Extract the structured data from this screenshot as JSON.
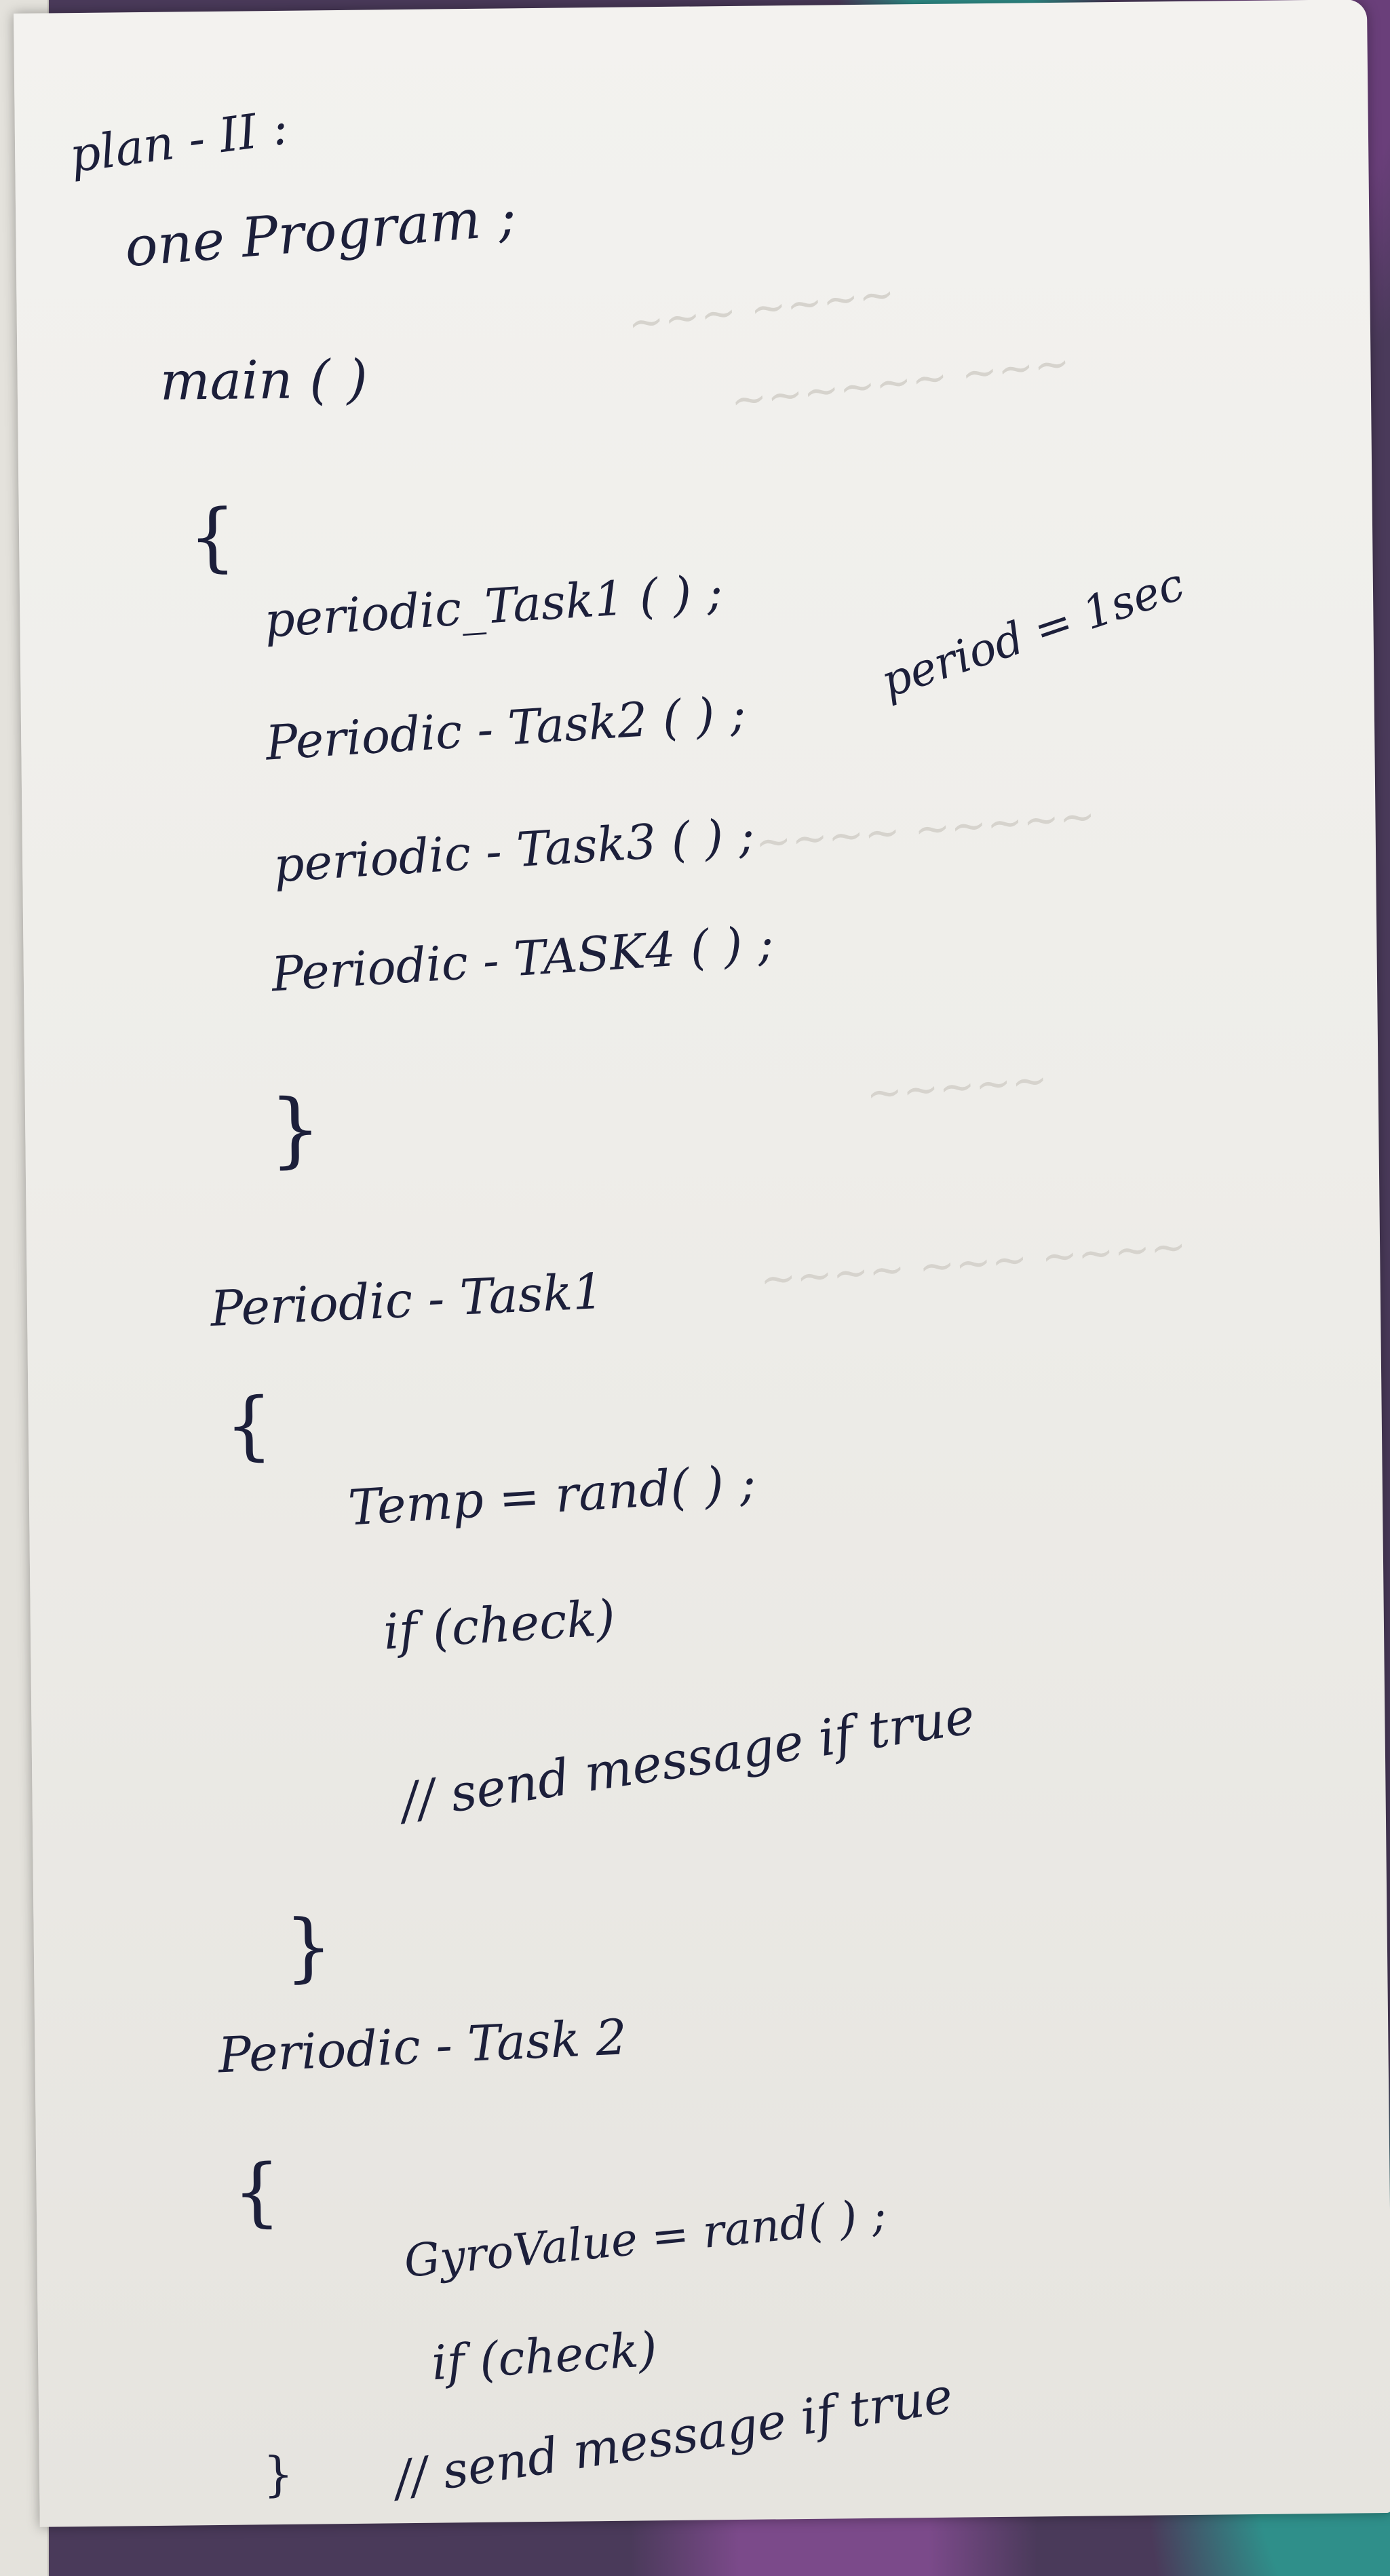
{
  "notes": {
    "heading": "plan - II :",
    "subheading": "one Program ;",
    "main": {
      "signature": "main ( )",
      "open_brace": "{",
      "calls": [
        "periodic_Task1 ( ) ;",
        "Periodic - Task2 ( ) ;",
        "periodic - Task3 ( ) ;",
        "Periodic - TASK4 ( ) ;"
      ],
      "side_note": "period = 1sec",
      "close_brace": "}"
    },
    "task1": {
      "name": "Periodic - Task1",
      "open_brace": "{",
      "lines": [
        "Temp = rand( ) ;",
        "if (check)",
        "// send message if true"
      ],
      "close_brace": "}"
    },
    "task2": {
      "name": "Periodic - Task 2",
      "open_brace": "{",
      "lines": [
        "GyroValue = rand( ) ;",
        "if (check)",
        "// send message if true"
      ],
      "close_brace": "}"
    }
  }
}
